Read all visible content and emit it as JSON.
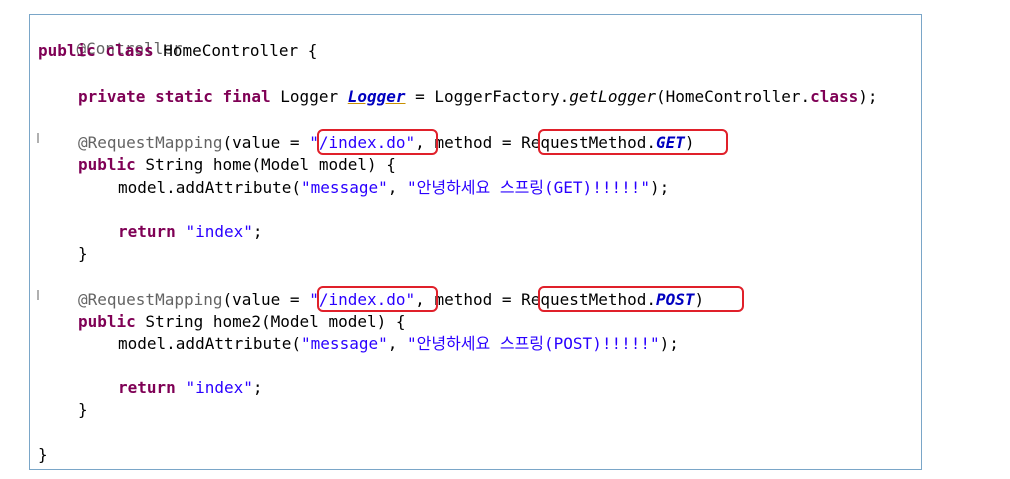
{
  "code": {
    "l1": {
      "ann": "@Controller"
    },
    "l2": {
      "kw": "public class",
      "rest": " HomeController {"
    },
    "l3": {
      "kw": "private static final",
      "type": " Logger ",
      "field": "Logger",
      "eq": " = LoggerFactory.",
      "method": "getLogger",
      "arg": "(HomeController.",
      "kw2": "class",
      "end": ");"
    },
    "l4": {
      "ann": "@RequestMapping",
      "open": "(value = ",
      "path": "\"/index.do\"",
      "mid": ", method = ",
      "enum_prefix": "RequestMethod.",
      "enum_val": "GET",
      "close": ")"
    },
    "l5": {
      "kw": "public",
      "rest": " String home(Model model) {"
    },
    "l6": {
      "pre": "model.addAttribute(",
      "key": "\"message\"",
      "sep": ", ",
      "msg": "\"안녕하세요 스프링(GET)!!!!!\"",
      "end": ");"
    },
    "l7": {
      "kw": "return",
      "sp": " ",
      "val": "\"index\"",
      "end": ";"
    },
    "l8": {
      "text": "}"
    },
    "l9": {
      "ann": "@RequestMapping",
      "open": "(value = ",
      "path": "\"/index.do\"",
      "mid": ", method = ",
      "enum_prefix": "RequestMethod.",
      "enum_val": "POST",
      "close": ")"
    },
    "l10": {
      "kw": "public",
      "rest": " String home2(Model model) {"
    },
    "l11": {
      "pre": "model.addAttribute(",
      "key": "\"message\"",
      "sep": ", ",
      "msg": "\"안녕하세요 스프링(POST)!!!!!\"",
      "end": ");"
    },
    "l12": {
      "kw": "return",
      "sp": " ",
      "val": "\"index\"",
      "end": ";"
    },
    "l13": {
      "text": "}"
    },
    "l14": {
      "text": "}"
    }
  },
  "colors": {
    "keyword": "#7f0055",
    "string": "#2a00ff",
    "annotation": "#646464",
    "highlight": "#e0202a",
    "border": "#7aa6c8"
  }
}
